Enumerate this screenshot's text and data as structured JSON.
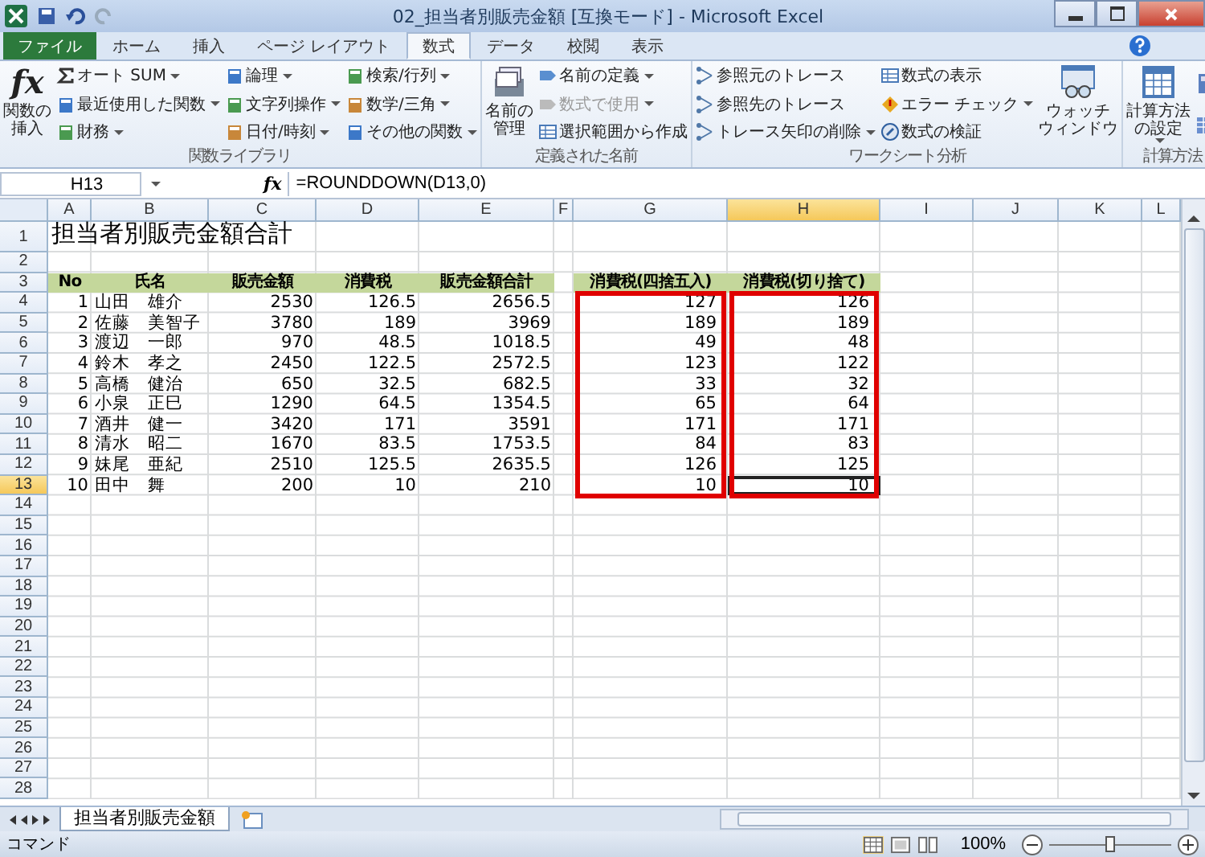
{
  "window": {
    "title": "02_担当者別販売金額 [互換モード] - Microsoft Excel"
  },
  "tabs": [
    {
      "label": "ファイル",
      "selected": false,
      "kind": "file"
    },
    {
      "label": "ホーム",
      "selected": false,
      "kind": "tab"
    },
    {
      "label": "挿入",
      "selected": false,
      "kind": "tab"
    },
    {
      "label": "ページ レイアウト",
      "selected": false,
      "kind": "tab"
    },
    {
      "label": "数式",
      "selected": true,
      "kind": "tab"
    },
    {
      "label": "データ",
      "selected": false,
      "kind": "tab"
    },
    {
      "label": "校閲",
      "selected": false,
      "kind": "tab"
    },
    {
      "label": "表示",
      "selected": false,
      "kind": "tab"
    }
  ],
  "ribbon_groups": [
    {
      "label": "関数ライブラリ",
      "big": [
        {
          "symbol": "fx",
          "lines": [
            "関数の",
            "挿入"
          ],
          "dropdown": false
        }
      ],
      "columns": [
        [
          {
            "label": "オート SUM",
            "dropdown": true,
            "disabled": false
          },
          {
            "label": "最近使用した関数",
            "dropdown": true,
            "disabled": false
          },
          {
            "label": "財務",
            "dropdown": true,
            "disabled": false
          }
        ],
        [
          {
            "label": "論理",
            "dropdown": true,
            "disabled": false
          },
          {
            "label": "文字列操作",
            "dropdown": true,
            "disabled": false
          },
          {
            "label": "日付/時刻",
            "dropdown": true,
            "disabled": false
          }
        ],
        [
          {
            "label": "検索/行列",
            "dropdown": true,
            "disabled": false
          },
          {
            "label": "数学/三角",
            "dropdown": true,
            "disabled": false
          },
          {
            "label": "その他の関数",
            "dropdown": true,
            "disabled": false
          }
        ]
      ]
    },
    {
      "label": "定義された名前",
      "big": [
        {
          "lines": [
            "名前の",
            "管理"
          ],
          "dropdown": false
        }
      ],
      "columns": [
        [
          {
            "label": "名前の定義",
            "dropdown": true,
            "disabled": false
          },
          {
            "label": "数式で使用",
            "dropdown": true,
            "disabled": true
          },
          {
            "label": "選択範囲から作成",
            "dropdown": false,
            "disabled": false
          }
        ]
      ]
    },
    {
      "label": "ワークシート分析",
      "columns": [
        [
          {
            "label": "参照元のトレース",
            "dropdown": false,
            "disabled": false
          },
          {
            "label": "参照先のトレース",
            "dropdown": false,
            "disabled": false
          },
          {
            "label": "トレース矢印の削除",
            "dropdown": true,
            "disabled": false
          }
        ],
        [
          {
            "label": "数式の表示",
            "dropdown": false,
            "disabled": false
          },
          {
            "label": "エラー チェック",
            "dropdown": true,
            "disabled": false
          },
          {
            "label": "数式の検証",
            "dropdown": false,
            "disabled": false
          }
        ]
      ],
      "big_after": [
        {
          "lines": [
            "ウォッチ",
            "ウィンドウ"
          ],
          "dropdown": false
        }
      ]
    },
    {
      "label": "計算方法",
      "big": [
        {
          "lines": [
            "計算方法",
            "の設定"
          ],
          "dropdown": true
        }
      ]
    }
  ],
  "formula_bar": {
    "name_box": "H13",
    "function_button": "fx",
    "formula": "=ROUNDDOWN(D13,0)"
  },
  "sheet": {
    "columns": [
      {
        "label": "A",
        "selected": false
      },
      {
        "label": "B",
        "selected": false
      },
      {
        "label": "C",
        "selected": false
      },
      {
        "label": "D",
        "selected": false
      },
      {
        "label": "E",
        "selected": false
      },
      {
        "label": "F",
        "selected": false
      },
      {
        "label": "G",
        "selected": false
      },
      {
        "label": "H",
        "selected": true
      },
      {
        "label": "I",
        "selected": false
      },
      {
        "label": "J",
        "selected": false
      },
      {
        "label": "K",
        "selected": false
      },
      {
        "label": "L",
        "selected": false
      }
    ],
    "rows": [
      {
        "label": "1",
        "selected": false
      },
      {
        "label": "2",
        "selected": false
      },
      {
        "label": "3",
        "selected": false
      },
      {
        "label": "4",
        "selected": false
      },
      {
        "label": "5",
        "selected": false
      },
      {
        "label": "6",
        "selected": false
      },
      {
        "label": "7",
        "selected": false
      },
      {
        "label": "8",
        "selected": false
      },
      {
        "label": "9",
        "selected": false
      },
      {
        "label": "10",
        "selected": false
      },
      {
        "label": "11",
        "selected": false
      },
      {
        "label": "12",
        "selected": false
      },
      {
        "label": "13",
        "selected": true
      },
      {
        "label": "14",
        "selected": false
      },
      {
        "label": "15",
        "selected": false
      },
      {
        "label": "16",
        "selected": false
      },
      {
        "label": "17",
        "selected": false
      },
      {
        "label": "18",
        "selected": false
      },
      {
        "label": "19",
        "selected": false
      },
      {
        "label": "20",
        "selected": false
      },
      {
        "label": "21",
        "selected": false
      },
      {
        "label": "22",
        "selected": false
      },
      {
        "label": "23",
        "selected": false
      },
      {
        "label": "24",
        "selected": false
      },
      {
        "label": "25",
        "selected": false
      },
      {
        "label": "26",
        "selected": false
      },
      {
        "label": "27",
        "selected": false
      },
      {
        "label": "28",
        "selected": false
      }
    ],
    "title": "担当者別販売金額合計",
    "table": {
      "headers": [
        "No",
        "氏名",
        "販売金額",
        "消費税",
        "販売金額合計",
        "消費税(四捨五入)",
        "消費税(切り捨て)"
      ],
      "rows": [
        [
          "1",
          "山田　雄介",
          "2530",
          "126.5",
          "2656.5",
          "127",
          "126"
        ],
        [
          "2",
          "佐藤　美智子",
          "3780",
          "189",
          "3969",
          "189",
          "189"
        ],
        [
          "3",
          "渡辺　一郎",
          "970",
          "48.5",
          "1018.5",
          "49",
          "48"
        ],
        [
          "4",
          "鈴木　孝之",
          "2450",
          "122.5",
          "2572.5",
          "123",
          "122"
        ],
        [
          "5",
          "高橋　健治",
          "650",
          "32.5",
          "682.5",
          "33",
          "32"
        ],
        [
          "6",
          "小泉　正巳",
          "1290",
          "64.5",
          "1354.5",
          "65",
          "64"
        ],
        [
          "7",
          "酒井　健一",
          "3420",
          "171",
          "3591",
          "171",
          "171"
        ],
        [
          "8",
          "清水　昭二",
          "1670",
          "83.5",
          "1753.5",
          "84",
          "83"
        ],
        [
          "9",
          "妹尾　亜紀",
          "2510",
          "125.5",
          "2635.5",
          "126",
          "125"
        ],
        [
          "10",
          "田中　舞",
          "200",
          "10",
          "210",
          "10",
          "10"
        ]
      ]
    }
  },
  "sheet_tabs": [
    {
      "label": "担当者別販売金額",
      "selected": true
    }
  ],
  "status_bar": {
    "mode": "コマンド",
    "zoom": "100%",
    "zoom_slider": {
      "level": 0.5
    }
  }
}
